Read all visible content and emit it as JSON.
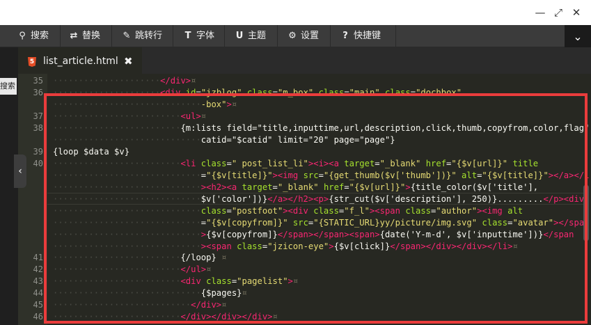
{
  "window": {
    "minimize": "—",
    "maximize": "⤢",
    "close": "✕"
  },
  "toolbar": {
    "search": "搜索",
    "replace": "替换",
    "goto_line": "跳转行",
    "font": "字体",
    "theme": "主题",
    "settings": "设置",
    "shortcuts": "快捷键"
  },
  "left_panel": {
    "search_label": "搜索"
  },
  "tab": {
    "label": "list_article.html",
    "close": "✖"
  },
  "line_numbers": [
    "35",
    "36",
    "37",
    "38",
    "39",
    "40",
    "41",
    "42",
    "43",
    "44",
    "45",
    "46"
  ]
}
